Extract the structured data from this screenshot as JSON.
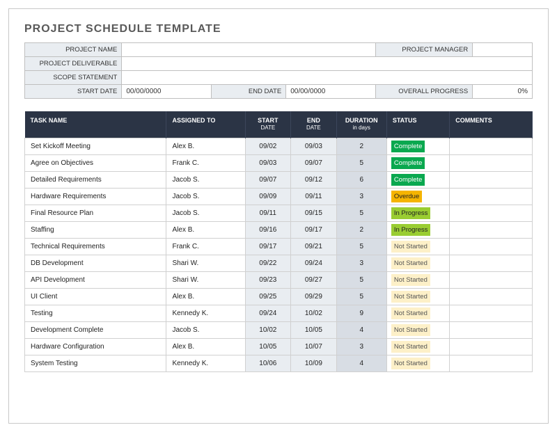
{
  "title": "PROJECT SCHEDULE TEMPLATE",
  "info": {
    "project_name_label": "PROJECT NAME",
    "project_name": "",
    "project_manager_label": "PROJECT MANAGER",
    "project_manager": "",
    "project_deliverable_label": "PROJECT DELIVERABLE",
    "project_deliverable": "",
    "scope_statement_label": "SCOPE STATEMENT",
    "scope_statement": "",
    "start_date_label": "START DATE",
    "start_date": "00/00/0000",
    "end_date_label": "END DATE",
    "end_date": "00/00/0000",
    "overall_progress_label": "OVERALL PROGRESS",
    "overall_progress": "0%"
  },
  "headers": {
    "task": "TASK NAME",
    "assigned": "ASSIGNED TO",
    "start": "START",
    "start_sub": "DATE",
    "end": "END",
    "end_sub": "DATE",
    "duration": "DURATION",
    "duration_sub": "in days",
    "status": "STATUS",
    "comments": "COMMENTS"
  },
  "statusClass": {
    "Complete": "st-complete",
    "Overdue": "st-overdue",
    "In Progress": "st-progress",
    "Not Started": "st-notstarted"
  },
  "rows": [
    {
      "task": "Set Kickoff Meeting",
      "assigned": "Alex B.",
      "start": "09/02",
      "end": "09/03",
      "dur": "2",
      "status": "Complete",
      "comments": ""
    },
    {
      "task": "Agree on Objectives",
      "assigned": "Frank C.",
      "start": "09/03",
      "end": "09/07",
      "dur": "5",
      "status": "Complete",
      "comments": ""
    },
    {
      "task": "Detailed Requirements",
      "assigned": "Jacob S.",
      "start": "09/07",
      "end": "09/12",
      "dur": "6",
      "status": "Complete",
      "comments": ""
    },
    {
      "task": "Hardware Requirements",
      "assigned": "Jacob S.",
      "start": "09/09",
      "end": "09/11",
      "dur": "3",
      "status": "Overdue",
      "comments": ""
    },
    {
      "task": "Final Resource Plan",
      "assigned": "Jacob S.",
      "start": "09/11",
      "end": "09/15",
      "dur": "5",
      "status": "In Progress",
      "comments": ""
    },
    {
      "task": "Staffing",
      "assigned": "Alex B.",
      "start": "09/16",
      "end": "09/17",
      "dur": "2",
      "status": "In Progress",
      "comments": ""
    },
    {
      "task": "Technical Requirements",
      "assigned": "Frank C.",
      "start": "09/17",
      "end": "09/21",
      "dur": "5",
      "status": "Not Started",
      "comments": ""
    },
    {
      "task": "DB Development",
      "assigned": "Shari W.",
      "start": "09/22",
      "end": "09/24",
      "dur": "3",
      "status": "Not Started",
      "comments": ""
    },
    {
      "task": "API Development",
      "assigned": "Shari W.",
      "start": "09/23",
      "end": "09/27",
      "dur": "5",
      "status": "Not Started",
      "comments": ""
    },
    {
      "task": "UI Client",
      "assigned": "Alex B.",
      "start": "09/25",
      "end": "09/29",
      "dur": "5",
      "status": "Not Started",
      "comments": ""
    },
    {
      "task": "Testing",
      "assigned": "Kennedy K.",
      "start": "09/24",
      "end": "10/02",
      "dur": "9",
      "status": "Not Started",
      "comments": ""
    },
    {
      "task": "Development Complete",
      "assigned": "Jacob S.",
      "start": "10/02",
      "end": "10/05",
      "dur": "4",
      "status": "Not Started",
      "comments": ""
    },
    {
      "task": "Hardware Configuration",
      "assigned": "Alex B.",
      "start": "10/05",
      "end": "10/07",
      "dur": "3",
      "status": "Not Started",
      "comments": ""
    },
    {
      "task": "System Testing",
      "assigned": "Kennedy K.",
      "start": "10/06",
      "end": "10/09",
      "dur": "4",
      "status": "Not Started",
      "comments": ""
    }
  ]
}
